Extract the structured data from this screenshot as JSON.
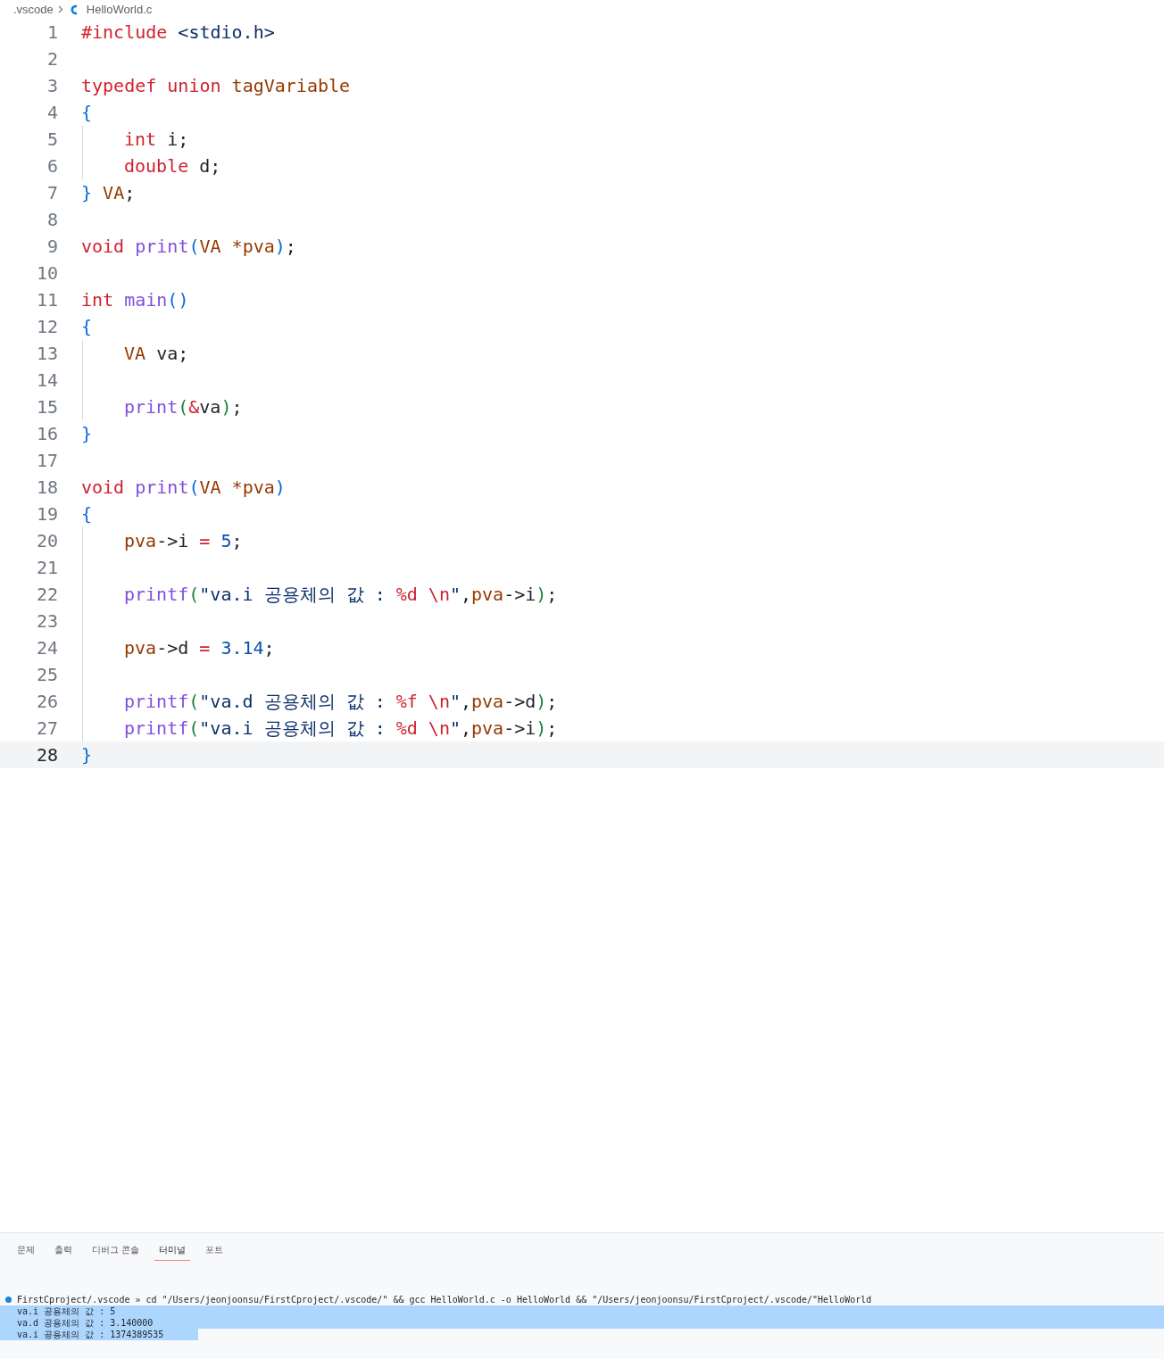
{
  "breadcrumb": {
    "folder": ".vscode",
    "file": "HelloWorld.c"
  },
  "code_lines": [
    {
      "number": "1",
      "current": false,
      "indent_guide": false,
      "tokens": [
        {
          "kind": "kw",
          "text": "#include"
        },
        {
          "kind": "str",
          "text": " <stdio.h>"
        }
      ]
    },
    {
      "number": "2",
      "current": false,
      "indent_guide": false
    },
    {
      "number": "3",
      "current": false,
      "indent_guide": false,
      "tokens": [
        {
          "kind": "kw",
          "text": "typedef union"
        },
        {
          "kind": "type",
          "text": " tagVariable"
        }
      ]
    },
    {
      "number": "4",
      "current": false,
      "indent_guide": false,
      "tokens": [
        {
          "kind": "br1",
          "text": "{"
        }
      ]
    },
    {
      "number": "5",
      "current": false,
      "indent_guide": true,
      "tokens": [
        {
          "kind": "kw",
          "text": "int"
        },
        {
          "kind": "plain",
          "text": " i;"
        }
      ]
    },
    {
      "number": "6",
      "current": false,
      "indent_guide": true,
      "tokens": [
        {
          "kind": "kw",
          "text": "double"
        },
        {
          "kind": "plain",
          "text": " d;"
        }
      ]
    },
    {
      "number": "7",
      "current": false,
      "indent_guide": false,
      "tokens": [
        {
          "kind": "br1",
          "text": "}"
        },
        {
          "kind": "type",
          "text": " VA"
        },
        {
          "kind": "plain",
          "text": ";"
        }
      ]
    },
    {
      "number": "8",
      "current": false,
      "indent_guide": false
    },
    {
      "number": "9",
      "current": false,
      "indent_guide": false,
      "tokens": [
        {
          "kind": "kw",
          "text": "void"
        },
        {
          "kind": "fn",
          "text": " print"
        },
        {
          "kind": "br1",
          "text": "("
        },
        {
          "kind": "type",
          "text": "VA"
        },
        {
          "kind": "var",
          "text": " *pva"
        },
        {
          "kind": "br1",
          "text": ")"
        },
        {
          "kind": "plain",
          "text": ";"
        }
      ]
    },
    {
      "number": "10",
      "current": false,
      "indent_guide": false
    },
    {
      "number": "11",
      "current": false,
      "indent_guide": false,
      "tokens": [
        {
          "kind": "kw",
          "text": "int"
        },
        {
          "kind": "fn",
          "text": " main"
        },
        {
          "kind": "br1",
          "text": "()"
        }
      ]
    },
    {
      "number": "12",
      "current": false,
      "indent_guide": false,
      "tokens": [
        {
          "kind": "br1",
          "text": "{"
        }
      ]
    },
    {
      "number": "13",
      "current": false,
      "indent_guide": true,
      "tokens": [
        {
          "kind": "type",
          "text": "VA"
        },
        {
          "kind": "plain",
          "text": " va;"
        }
      ]
    },
    {
      "number": "14",
      "current": false,
      "indent_guide": true
    },
    {
      "number": "15",
      "current": false,
      "indent_guide": true,
      "tokens": [
        {
          "kind": "fn",
          "text": "print"
        },
        {
          "kind": "br2",
          "text": "("
        },
        {
          "kind": "kw",
          "text": "&"
        },
        {
          "kind": "plain",
          "text": "va"
        },
        {
          "kind": "br2",
          "text": ")"
        },
        {
          "kind": "plain",
          "text": ";"
        }
      ]
    },
    {
      "number": "16",
      "current": false,
      "indent_guide": false,
      "tokens": [
        {
          "kind": "br1",
          "text": "}"
        }
      ]
    },
    {
      "number": "17",
      "current": false,
      "indent_guide": false
    },
    {
      "number": "18",
      "current": false,
      "indent_guide": false,
      "tokens": [
        {
          "kind": "kw",
          "text": "void"
        },
        {
          "kind": "fn",
          "text": " print"
        },
        {
          "kind": "br1",
          "text": "("
        },
        {
          "kind": "type",
          "text": "VA"
        },
        {
          "kind": "var",
          "text": " *pva"
        },
        {
          "kind": "br1",
          "text": ")"
        }
      ]
    },
    {
      "number": "19",
      "current": false,
      "indent_guide": false,
      "tokens": [
        {
          "kind": "br1",
          "text": "{"
        }
      ]
    },
    {
      "number": "20",
      "current": false,
      "indent_guide": true,
      "tokens": [
        {
          "kind": "var",
          "text": "pva"
        },
        {
          "kind": "plain",
          "text": "->i "
        },
        {
          "kind": "kw",
          "text": "="
        },
        {
          "kind": "num",
          "text": " 5"
        },
        {
          "kind": "plain",
          "text": ";"
        }
      ]
    },
    {
      "number": "21",
      "current": false,
      "indent_guide": true
    },
    {
      "number": "22",
      "current": false,
      "indent_guide": true,
      "tokens": [
        {
          "kind": "fn",
          "text": "printf"
        },
        {
          "kind": "br2",
          "text": "("
        },
        {
          "kind": "str",
          "text": "\"va.i 공용체의 값 : "
        },
        {
          "kind": "kw",
          "text": "%d \\n"
        },
        {
          "kind": "str",
          "text": "\""
        },
        {
          "kind": "plain",
          "text": ","
        },
        {
          "kind": "var",
          "text": "pva"
        },
        {
          "kind": "plain",
          "text": "->i"
        },
        {
          "kind": "br2",
          "text": ")"
        },
        {
          "kind": "plain",
          "text": ";"
        }
      ]
    },
    {
      "number": "23",
      "current": false,
      "indent_guide": true
    },
    {
      "number": "24",
      "current": false,
      "indent_guide": true,
      "tokens": [
        {
          "kind": "var",
          "text": "pva"
        },
        {
          "kind": "plain",
          "text": "->d "
        },
        {
          "kind": "kw",
          "text": "="
        },
        {
          "kind": "num",
          "text": " 3.14"
        },
        {
          "kind": "plain",
          "text": ";"
        }
      ]
    },
    {
      "number": "25",
      "current": false,
      "indent_guide": true
    },
    {
      "number": "26",
      "current": false,
      "indent_guide": true,
      "tokens": [
        {
          "kind": "fn",
          "text": "printf"
        },
        {
          "kind": "br2",
          "text": "("
        },
        {
          "kind": "str",
          "text": "\"va.d 공용체의 값 : "
        },
        {
          "kind": "kw",
          "text": "%f \\n"
        },
        {
          "kind": "str",
          "text": "\""
        },
        {
          "kind": "plain",
          "text": ","
        },
        {
          "kind": "var",
          "text": "pva"
        },
        {
          "kind": "plain",
          "text": "->d"
        },
        {
          "kind": "br2",
          "text": ")"
        },
        {
          "kind": "plain",
          "text": ";"
        }
      ]
    },
    {
      "number": "27",
      "current": false,
      "indent_guide": true,
      "tokens": [
        {
          "kind": "fn",
          "text": "printf"
        },
        {
          "kind": "br2",
          "text": "("
        },
        {
          "kind": "str",
          "text": "\"va.i 공용체의 값 : "
        },
        {
          "kind": "kw",
          "text": "%d \\n"
        },
        {
          "kind": "str",
          "text": "\""
        },
        {
          "kind": "plain",
          "text": ","
        },
        {
          "kind": "var",
          "text": "pva"
        },
        {
          "kind": "plain",
          "text": "->i"
        },
        {
          "kind": "br2",
          "text": ")"
        },
        {
          "kind": "plain",
          "text": ";"
        }
      ]
    },
    {
      "number": "28",
      "current": true,
      "indent_guide": false,
      "tokens": [
        {
          "kind": "br1",
          "text": "}"
        }
      ]
    }
  ],
  "panel": {
    "tabs": [
      {
        "label": "문제",
        "selected": false
      },
      {
        "label": "출력",
        "selected": false
      },
      {
        "label": "디버그 콘솔",
        "selected": false
      },
      {
        "label": "터미널",
        "selected": true
      },
      {
        "label": "포트",
        "selected": false
      }
    ],
    "terminal": {
      "prompt": "FirstCproject/.vscode » cd \"/Users/jeonjoonsu/FirstCproject/.vscode/\" && gcc HelloWorld.c -o HelloWorld && \"/Users/jeonjoonsu/FirstCproject/.vscode/\"HelloWorld",
      "output": [
        {
          "text": "va.i 공용체의 값 : 5",
          "selected": true,
          "kind": "full_width"
        },
        {
          "text": "va.d 공용체의 값 : 3.140000",
          "selected": true,
          "kind": "full_width"
        },
        {
          "text": "va.i 공용체의 값 : 1374389535",
          "selected": true,
          "kind": "text_width"
        }
      ]
    }
  }
}
